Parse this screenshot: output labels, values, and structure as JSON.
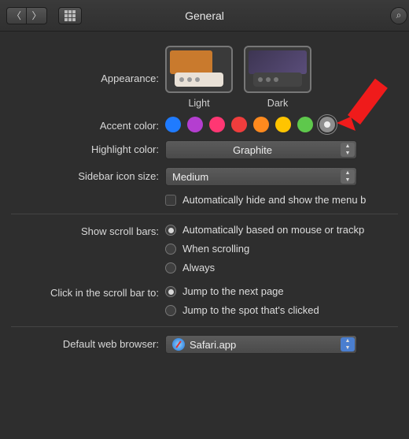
{
  "window": {
    "title": "General"
  },
  "appearance": {
    "label": "Appearance:",
    "options": [
      {
        "label": "Light"
      },
      {
        "label": "Dark"
      }
    ]
  },
  "accent": {
    "label": "Accent color:",
    "colors": [
      "#1f7bff",
      "#b43ed0",
      "#ff3773",
      "#ef3d3d",
      "#ff8a1e",
      "#ffc400",
      "#5ec84c",
      "#8e8e8e"
    ],
    "selected_index": 7
  },
  "highlight": {
    "label": "Highlight color:",
    "value": "Graphite"
  },
  "sidebar_size": {
    "label": "Sidebar icon size:",
    "value": "Medium"
  },
  "menubar_autohide": {
    "label": "Automatically hide and show the menu b"
  },
  "scrollbars": {
    "label": "Show scroll bars:",
    "options": [
      "Automatically based on mouse or trackp",
      "When scrolling",
      "Always"
    ],
    "selected_index": 0
  },
  "scrollclick": {
    "label": "Click in the scroll bar to:",
    "options": [
      "Jump to the next page",
      "Jump to the spot that's clicked"
    ],
    "selected_index": 0
  },
  "browser": {
    "label": "Default web browser:",
    "value": "Safari.app"
  }
}
